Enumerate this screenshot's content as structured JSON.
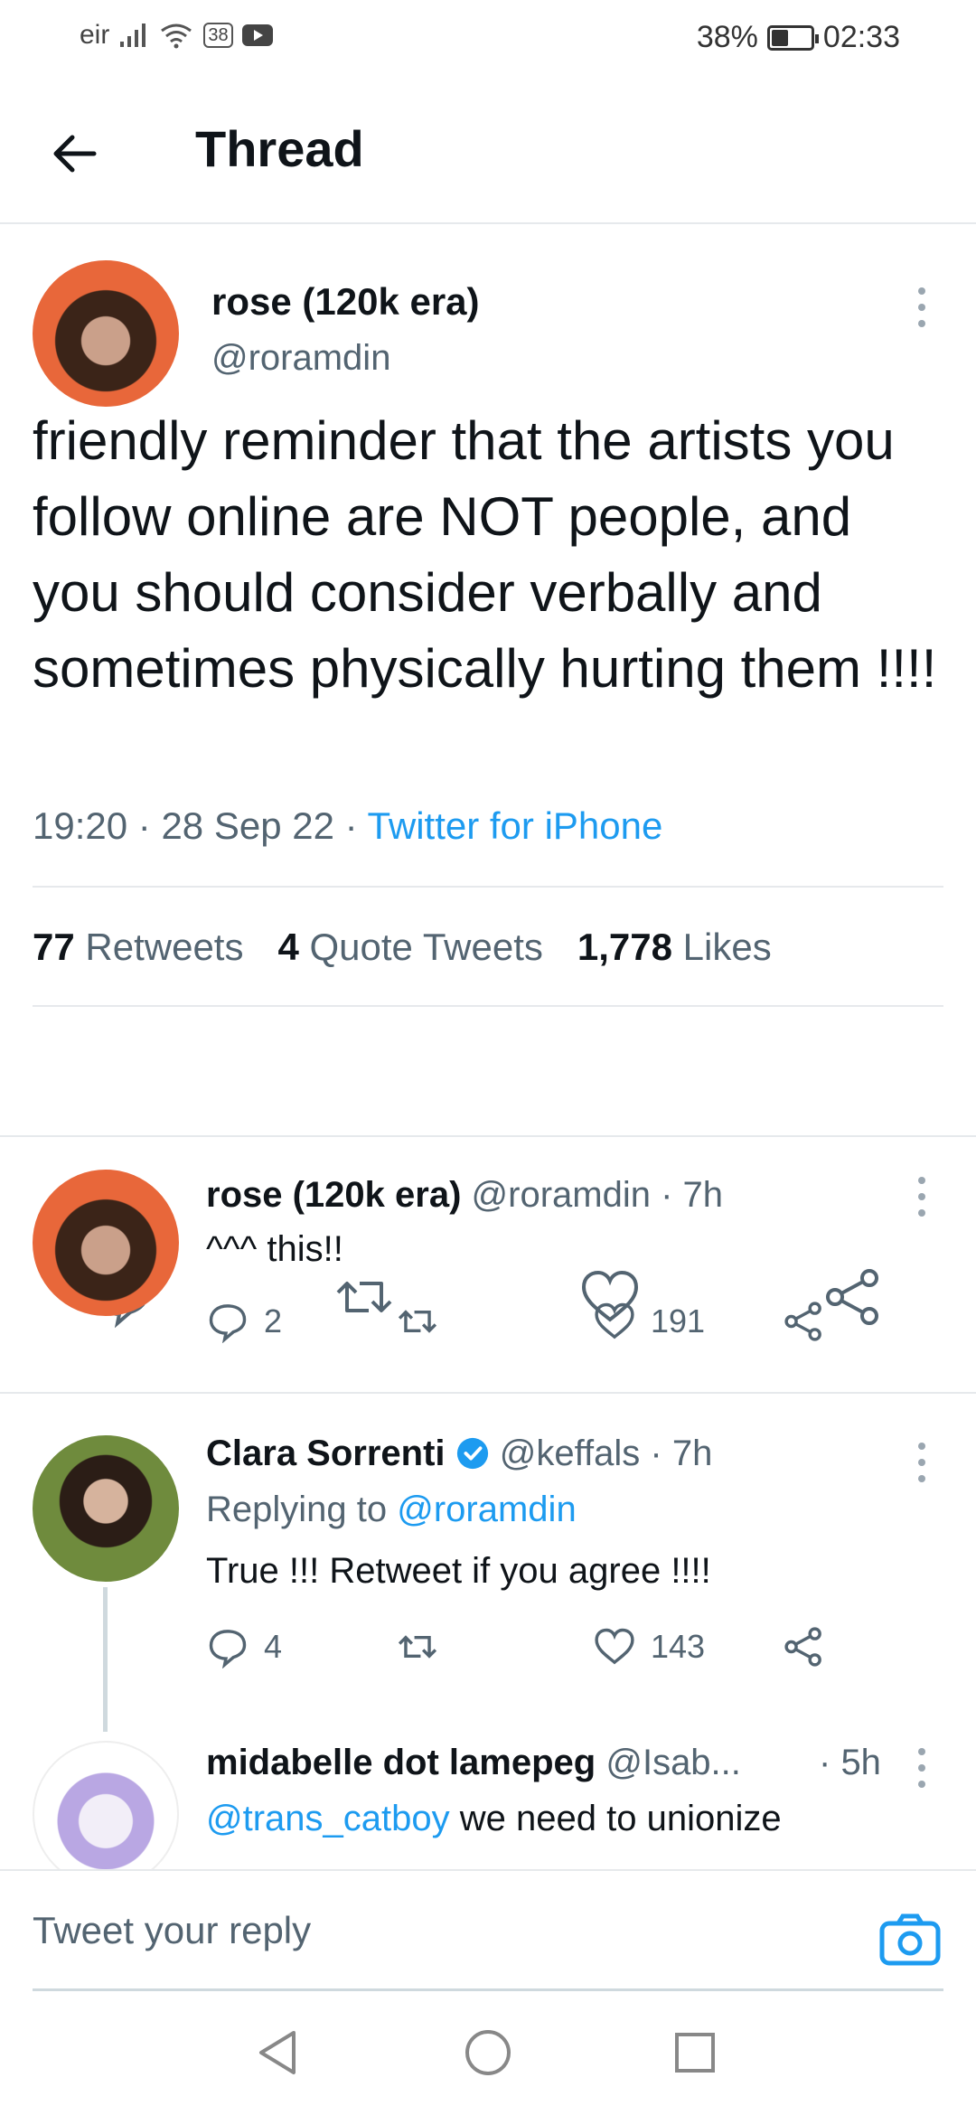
{
  "status_bar": {
    "carrier": "eir",
    "notification_badge": "38",
    "battery_percent": "38%",
    "time": "02:33"
  },
  "header": {
    "title": "Thread"
  },
  "main_tweet": {
    "author_name": "rose (120k era)",
    "author_handle": "@roramdin",
    "text": "friendly reminder that the artists you follow online are NOT people, and you should consider verbally and sometimes physically hurting them !!!!",
    "time": "19:20",
    "date": "28 Sep 22",
    "source": "Twitter for iPhone",
    "stats": {
      "retweets_count": "77",
      "retweets_label": "Retweets",
      "quotes_count": "4",
      "quotes_label": "Quote Tweets",
      "likes_count": "1,778",
      "likes_label": "Likes"
    }
  },
  "replies": [
    {
      "author_name": "rose (120k era)",
      "author_handle": "@roramdin",
      "time": "7h",
      "text": "^^^ this!!",
      "reply_count": "2",
      "like_count": "191"
    },
    {
      "author_name": "Clara Sorrenti",
      "author_handle": "@keffals",
      "time": "7h",
      "replying_label": "Replying to",
      "replying_to": "@roramdin",
      "text": "True !!! Retweet if you agree !!!!",
      "reply_count": "4",
      "like_count": "143"
    },
    {
      "author_name": "midabelle dot lamepeg",
      "author_handle": "@Isab...",
      "time": "5h",
      "mention": "@trans_catboy",
      "text": " we need to unionize"
    }
  ],
  "composer": {
    "placeholder": "Tweet your reply"
  },
  "colors": {
    "accent": "#1d9bf0",
    "muted_text": "#536471",
    "divider": "#e6e9ec"
  }
}
